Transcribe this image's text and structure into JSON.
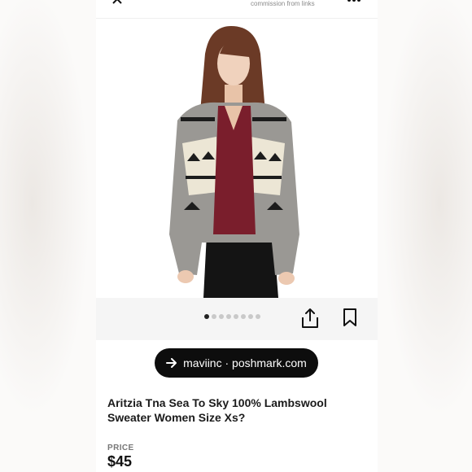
{
  "header": {
    "commission_text": "commission from links",
    "close_icon": "close-icon",
    "more_icon": "more-icon"
  },
  "gallery": {
    "image_count": 8,
    "active_index": 0,
    "share_icon": "share-icon",
    "bookmark_icon": "bookmark-icon"
  },
  "source_link": {
    "label": "maviinc · poshmark.com",
    "icon": "arrow-right-icon"
  },
  "product": {
    "title": "Aritzia Tna Sea To Sky 100% Lambswool Sweater Women Size Xs?",
    "price_label": "PRICE",
    "price": "$45"
  }
}
